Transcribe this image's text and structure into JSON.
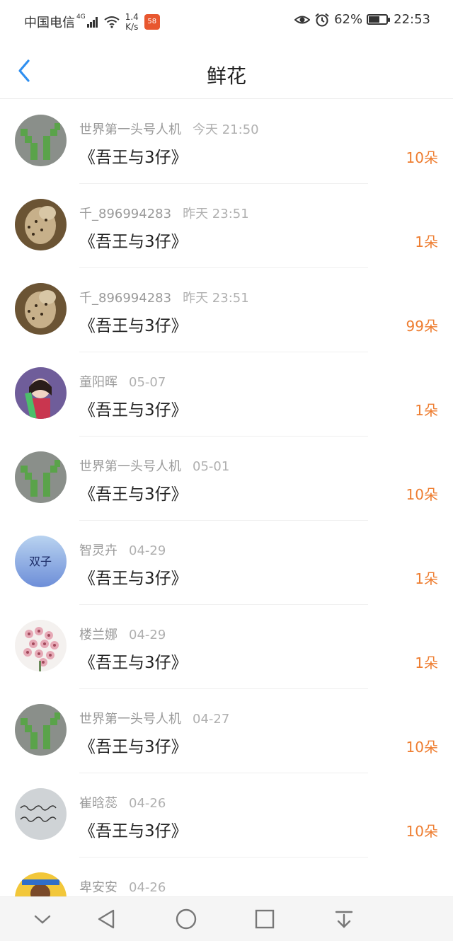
{
  "status": {
    "carrier": "中国电信",
    "network": "4G",
    "speed_value": "1.4",
    "speed_unit": "K/s",
    "app_badge": "58",
    "battery": "62%",
    "battery_level": 0.62,
    "time": "22:53",
    "icons": [
      "eye-icon",
      "alarm-icon",
      "wifi-icon",
      "signal-icon"
    ]
  },
  "header": {
    "title": "鲜花",
    "back_icon": "chevron-left-icon",
    "accent": "#2f8ff0"
  },
  "rows": [
    {
      "user": "世界第一头号人机",
      "time": "今天 21:50",
      "book": "《吾王与3仔》",
      "count": "10朵",
      "avatar": "green-y"
    },
    {
      "user": "千_896994283",
      "time": "昨天 23:51",
      "book": "《吾王与3仔》",
      "count": "1朵",
      "avatar": "cheetah"
    },
    {
      "user": "千_896994283",
      "time": "昨天 23:51",
      "book": "《吾王与3仔》",
      "count": "99朵",
      "avatar": "cheetah"
    },
    {
      "user": "童阳晖",
      "time": "05-07",
      "book": "《吾王与3仔》",
      "count": "1朵",
      "avatar": "girl"
    },
    {
      "user": "世界第一头号人机",
      "time": "05-01",
      "book": "《吾王与3仔》",
      "count": "10朵",
      "avatar": "green-y"
    },
    {
      "user": "智灵卉",
      "time": "04-29",
      "book": "《吾王与3仔》",
      "count": "1朵",
      "avatar": "twins",
      "avatar_text": "双子"
    },
    {
      "user": "楼兰娜",
      "time": "04-29",
      "book": "《吾王与3仔》",
      "count": "1朵",
      "avatar": "flowers"
    },
    {
      "user": "世界第一头号人机",
      "time": "04-27",
      "book": "《吾王与3仔》",
      "count": "10朵",
      "avatar": "green-y"
    },
    {
      "user": "崔晗蕊",
      "time": "04-26",
      "book": "《吾王与3仔》",
      "count": "10朵",
      "avatar": "handwriting"
    },
    {
      "user": "卑安安",
      "time": "04-26",
      "book": "",
      "count": "",
      "avatar": "cartoon"
    }
  ],
  "colors": {
    "count": "#ee7d30",
    "meta": "#9a9a9a"
  },
  "nav": [
    "chevron-down-icon",
    "back-triangle-icon",
    "home-circle-icon",
    "recent-square-icon",
    "download-icon"
  ]
}
